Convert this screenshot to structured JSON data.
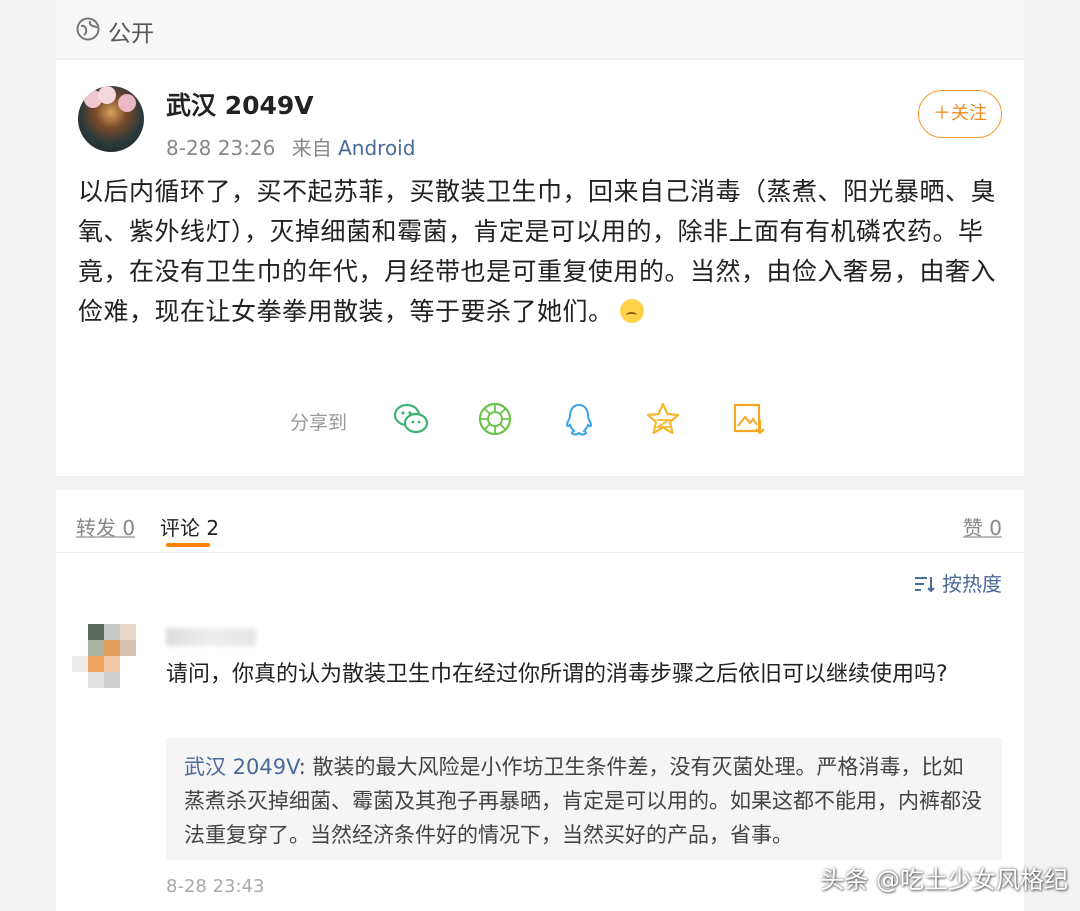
{
  "top": {
    "visibility": "公开",
    "icon": "globe-icon"
  },
  "post": {
    "author": "武汉 2049V",
    "time": "8-28 23:26",
    "from_prefix": "来自",
    "source": "Android",
    "follow_label": "＋关注",
    "body": "以后内循环了，买不起苏菲，买散装卫生巾，回来自己消毒（蒸煮、阳光暴晒、臭氧、紫外线灯），灭掉细菌和霉菌，肯定是可以用的，除非上面有有机磷农药。毕竟，在没有卫生巾的年代，月经带也是可重复使用的。当然，由俭入奢易，由奢入俭难，现在让女拳拳用散装，等于要杀了她们。",
    "share_label": "分享到",
    "share_icons": [
      "wechat-icon",
      "moments-icon",
      "qq-icon",
      "qzone-icon",
      "save-image-icon"
    ]
  },
  "tabs": {
    "repost": "转发 0",
    "comment": "评论 2",
    "like": "赞 0",
    "sort": "按热度"
  },
  "comment": {
    "text": "请问，你真的认为散装卫生巾在经过你所谓的消毒步骤之后依旧可以继续使用吗?",
    "reply_author": "武汉 2049V",
    "reply_text": "散装的最大风险是小作坊卫生条件差，没有灭菌处理。严格消毒，比如蒸煮杀灭掉细菌、霉菌及其孢子再暴晒，肯定是可以用的。如果这都不能用，内裤都没法重复穿了。当然经济条件好的情况下，当然买好的产品，省事。",
    "time": "8-28 23:43"
  },
  "watermark": "头条 @吃土少女风格纪",
  "colors": {
    "accent": "#ff8200",
    "link": "#4a6a9a",
    "wechat": "#3cb371",
    "qq": "#3aa4e8",
    "qzone": "#f5b82e"
  }
}
